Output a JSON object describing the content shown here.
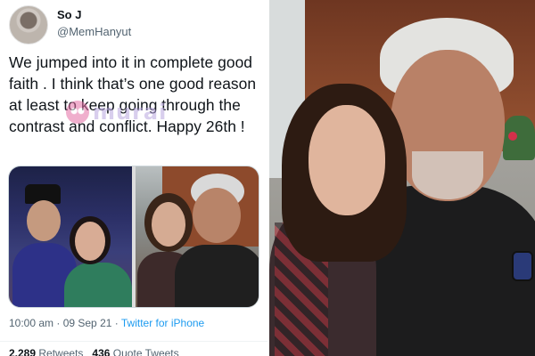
{
  "tweet": {
    "display_name": "So J",
    "handle": "@MemHanyut",
    "text": "We jumped into it in complete good faith . I think that’s one good reason at least to keep going through the contrast and conflict. Happy 26th !",
    "timestamp": "10:00 am · 09 Sep 21 · ",
    "source": "Twitter for iPhone",
    "stats": {
      "retweets_count": "2,289",
      "retweets_label": "Retweets",
      "quote_count": "436",
      "quote_label": "Quote Tweets"
    }
  },
  "watermark": {
    "text": "murai",
    "icon": "owl-logo-icon"
  },
  "colors": {
    "link": "#1d9bf0",
    "text": "#0f1419",
    "muted": "#536471"
  }
}
